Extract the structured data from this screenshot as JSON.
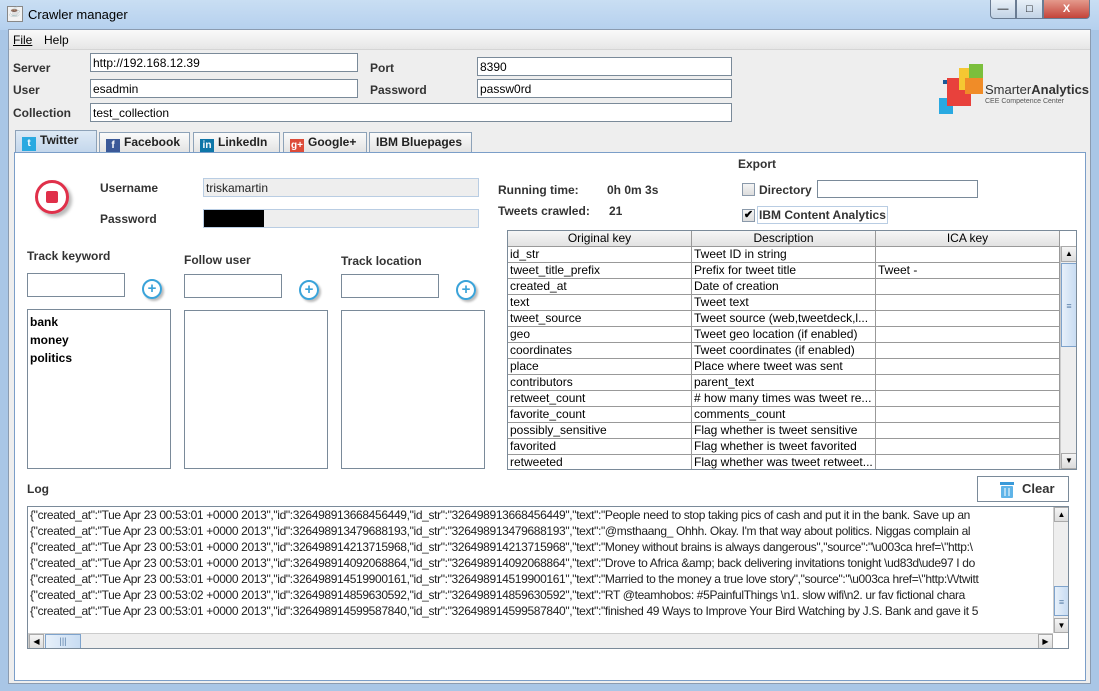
{
  "window": {
    "title": "Crawler manager",
    "minimize": "—",
    "maximize": "□",
    "close": "X"
  },
  "menu": [
    "File",
    "Help"
  ],
  "connection": {
    "server_label": "Server",
    "server_value": "http://192.168.12.39",
    "port_label": "Port",
    "port_value": "8390",
    "user_label": "User",
    "user_value": "esadmin",
    "password_label": "Password",
    "password_value": "passw0rd",
    "collection_label": "Collection",
    "collection_value": "test_collection"
  },
  "logo": {
    "brand_light": "Smarter",
    "brand_bold": "Analytics",
    "subtitle": "CEE Competence Center"
  },
  "tabs": [
    {
      "label": "Twitter",
      "icon": "twitter-icon",
      "color": "#29a9e1",
      "selected": true
    },
    {
      "label": "Facebook",
      "icon": "facebook-icon",
      "color": "#3b5998"
    },
    {
      "label": "LinkedIn",
      "icon": "linkedin-icon",
      "color": "#0e76a8"
    },
    {
      "label": "Google+",
      "icon": "google-plus-icon",
      "color": "#dd4b39"
    },
    {
      "label": "IBM Bluepages"
    }
  ],
  "twitter": {
    "username_label": "Username",
    "username_value": "triskamartin",
    "password_label": "Password",
    "password_fill": 0.22,
    "track_keyword_label": "Track keyword",
    "follow_user_label": "Follow user",
    "track_location_label": "Track location",
    "keywords": [
      "bank",
      "money",
      "politics"
    ],
    "running_time_label": "Running time:",
    "running_time_value": "0h 0m 3s",
    "tweets_crawled_label": "Tweets crawled:",
    "tweets_crawled_value": "21",
    "export": {
      "title": "Export",
      "directory_label": "Directory",
      "directory_checked": false,
      "directory_value": "",
      "ica_label": "IBM Content Analytics",
      "ica_checked": true,
      "check_mark": "✔"
    },
    "table": {
      "headers": [
        "Original key",
        "Description",
        "ICA key"
      ],
      "rows": [
        [
          "id_str",
          "Tweet ID in string",
          ""
        ],
        [
          "tweet_title_prefix",
          "Prefix for tweet title",
          "Tweet -"
        ],
        [
          "created_at",
          "Date of creation",
          ""
        ],
        [
          "text",
          "Tweet text",
          ""
        ],
        [
          "tweet_source",
          "Tweet source (web,tweetdeck,l...",
          ""
        ],
        [
          "geo",
          "Tweet geo location (if enabled)",
          ""
        ],
        [
          "coordinates",
          "Tweet coordinates (if enabled)",
          ""
        ],
        [
          "place",
          "Place where tweet was sent",
          ""
        ],
        [
          "contributors",
          "parent_text",
          ""
        ],
        [
          "retweet_count",
          "# how many times was tweet re...",
          ""
        ],
        [
          "favorite_count",
          "comments_count",
          ""
        ],
        [
          "possibly_sensitive",
          "Flag whether is tweet sensitive",
          ""
        ],
        [
          "favorited",
          "Flag whether is tweet favorited",
          ""
        ],
        [
          "retweeted",
          "Flag whether was tweet retweet...",
          ""
        ]
      ]
    },
    "log_label": "Log",
    "clear_label": "Clear",
    "log_lines": [
      "{\"created_at\":\"Tue Apr 23 00:53:01 +0000 2013\",\"id\":326498913668456449,\"id_str\":\"326498913668456449\",\"text\":\"People need to stop taking pics of cash and put it in the bank. Save up an",
      "{\"created_at\":\"Tue Apr 23 00:53:01 +0000 2013\",\"id\":326498913479688193,\"id_str\":\"326498913479688193\",\"text\":\"@msthaang_ Ohhh. Okay. I'm that way about politics. Niggas complain al",
      "{\"created_at\":\"Tue Apr 23 00:53:01 +0000 2013\",\"id\":326498914213715968,\"id_str\":\"326498914213715968\",\"text\":\"Money without brains is always dangerous\",\"source\":\"\\u003ca href=\\\"http:\\",
      "{\"created_at\":\"Tue Apr 23 00:53:01 +0000 2013\",\"id\":326498914092068864,\"id_str\":\"326498914092068864\",\"text\":\"Drove to Africa &amp; back delivering invitations tonight \\ud83d\\ude97 I do",
      "{\"created_at\":\"Tue Apr 23 00:53:01 +0000 2013\",\"id\":326498914519900161,\"id_str\":\"326498914519900161\",\"text\":\"Married to the money a true love story\",\"source\":\"\\u003ca href=\\\"http:\\/\\/twitt",
      "{\"created_at\":\"Tue Apr 23 00:53:02 +0000 2013\",\"id\":326498914859630592,\"id_str\":\"326498914859630592\",\"text\":\"RT @teamhobos: #5PainfulThings  \\n1. slow wifi\\n2. ur fav fictional chara",
      "{\"created_at\":\"Tue Apr 23 00:53:01 +0000 2013\",\"id\":326498914599587840,\"id_str\":\"326498914599587840\",\"text\":\"finished 49 Ways to Improve Your Bird Watching by J.S. Bank and gave it 5"
    ]
  }
}
